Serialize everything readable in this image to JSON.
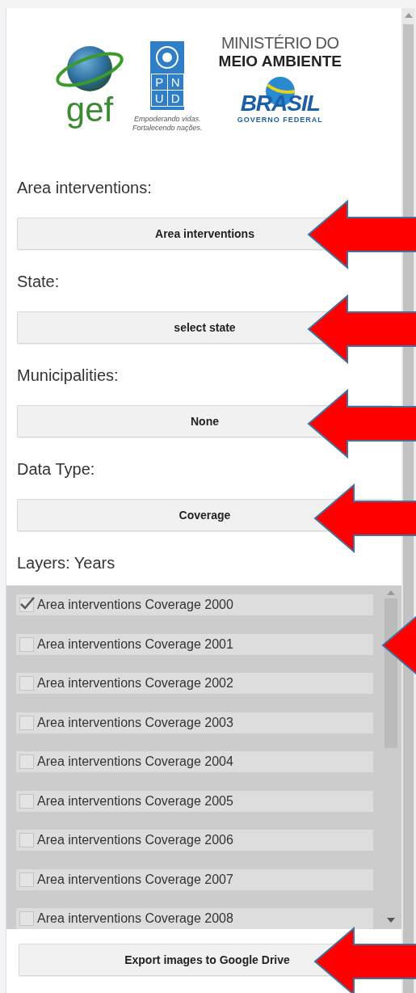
{
  "logos": {
    "gef": "gef",
    "pnud_letters": [
      "P",
      "N",
      "U",
      "D"
    ],
    "pnud_tagline": [
      "Empoderando vidas.",
      "Fortalecendo nações."
    ],
    "ministry": [
      "MINISTÉRIO DO",
      "MEIO AMBIENTE"
    ],
    "brasil": "BRASIL",
    "governo": "GOVERNO FEDERAL"
  },
  "fields": [
    {
      "label": "Area interventions:",
      "value": "Area interventions"
    },
    {
      "label": "State:",
      "value": "select state"
    },
    {
      "label": "Municipalities:",
      "value": "None"
    },
    {
      "label": "Data Type:",
      "value": "Coverage"
    }
  ],
  "layers": {
    "label": "Layers: Years",
    "items": [
      {
        "label": "Area interventions Coverage 2000",
        "checked": true
      },
      {
        "label": "Area interventions Coverage 2001",
        "checked": false
      },
      {
        "label": "Area interventions Coverage 2002",
        "checked": false
      },
      {
        "label": "Area interventions Coverage 2003",
        "checked": false
      },
      {
        "label": "Area interventions Coverage 2004",
        "checked": false
      },
      {
        "label": "Area interventions Coverage 2005",
        "checked": false
      },
      {
        "label": "Area interventions Coverage 2006",
        "checked": false
      },
      {
        "label": "Area interventions Coverage 2007",
        "checked": false
      },
      {
        "label": "Area interventions Coverage 2008",
        "checked": false
      }
    ]
  },
  "export_button": "Export images to Google Drive"
}
